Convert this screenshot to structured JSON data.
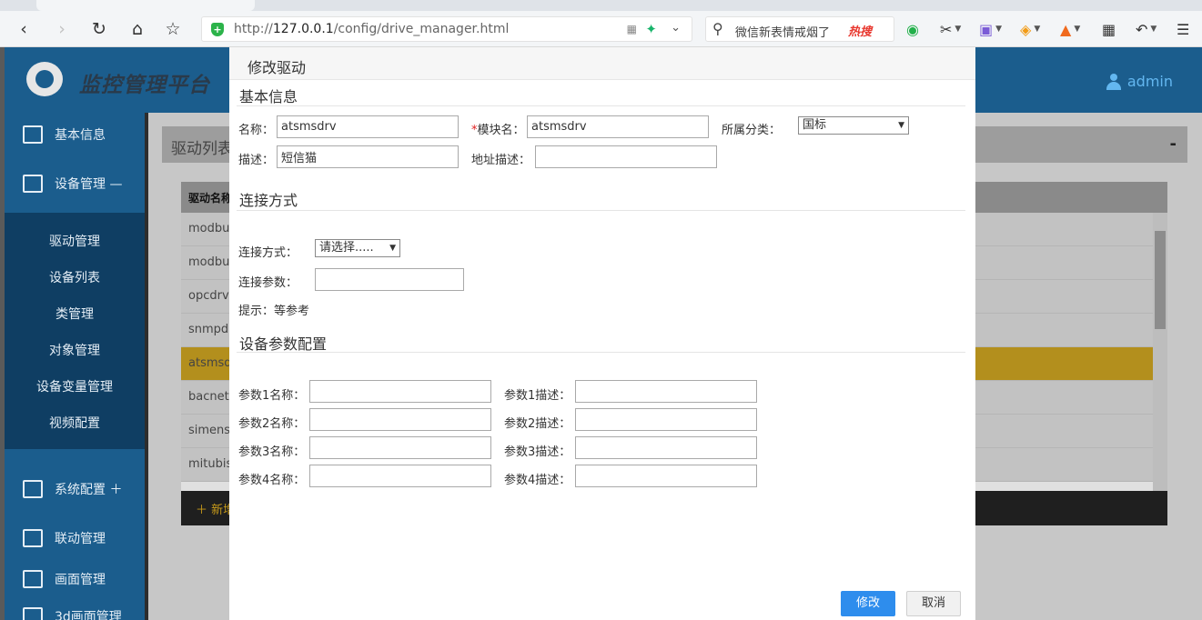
{
  "browser": {
    "address_url_prefix": "http://",
    "address_url_host": "127.0.0.1",
    "address_url_path": "/config/drive_manager.html",
    "search_text": "微信新表情戒烟了",
    "search_hot": "热搜"
  },
  "app": {
    "title": "监控管理平台",
    "user": "admin"
  },
  "sidebar": {
    "items": [
      {
        "label": "基本信息"
      },
      {
        "label": "设备管理 —"
      },
      {
        "label": "系统配置 ＋"
      },
      {
        "label": "联动管理"
      },
      {
        "label": "画面管理"
      },
      {
        "label": "3d画面管理"
      }
    ],
    "sub_items": [
      "驱动管理",
      "设备列表",
      "类管理",
      "对象管理",
      "设备变量管理",
      "视频配置"
    ]
  },
  "main": {
    "panel_title": "驱动列表",
    "collapse": "-",
    "grid_header": "驱动名称",
    "rows": [
      "modbus",
      "modbus",
      "opcdrv",
      "snmpdrv",
      "atsmsdrv",
      "bacnet",
      "simens",
      "mitubishi"
    ],
    "add_label": "＋ 新增"
  },
  "modal": {
    "title": "修改驱动",
    "basic": {
      "section": "基本信息",
      "name_label": "名称：",
      "name_value": "atsmsdrv",
      "module_required": "*",
      "module_label": "模块名：",
      "module_value": "atsmsdrv",
      "category_label": "所属分类：",
      "category_value": "国标",
      "desc_label": "描述：",
      "desc_value": "短信猫",
      "addr_desc_label": "地址描述：",
      "addr_desc_value": ""
    },
    "connection": {
      "section": "连接方式",
      "method_label": "连接方式：",
      "method_value": "请选择.....",
      "params_label": "连接参数：",
      "params_value": "",
      "hint": "提示：等参考"
    },
    "device_params": {
      "section": "设备参数配置",
      "rows": [
        {
          "name_label": "参数1名称：",
          "desc_label": "参数1描述："
        },
        {
          "name_label": "参数2名称：",
          "desc_label": "参数2描述："
        },
        {
          "name_label": "参数3名称：",
          "desc_label": "参数3描述："
        },
        {
          "name_label": "参数4名称：",
          "desc_label": "参数4描述："
        }
      ]
    },
    "buttons": {
      "submit": "修改",
      "cancel": "取消"
    }
  }
}
